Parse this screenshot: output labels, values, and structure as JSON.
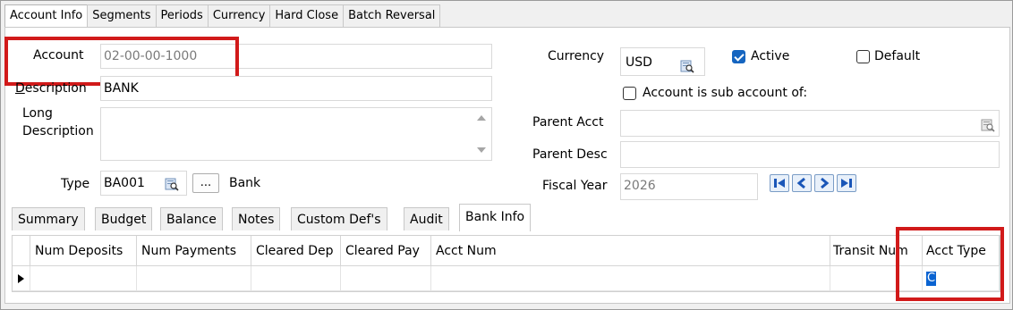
{
  "top_tabs": [
    "Account Info",
    "Segments",
    "Periods",
    "Currency",
    "Hard Close",
    "Batch Reversal"
  ],
  "form": {
    "account_label": "Account",
    "account_value": "02-00-00-1000",
    "description_label": "Description",
    "description_value": "BANK",
    "long_desc_label_1": "Long",
    "long_desc_label_2": "Description",
    "long_desc_value": "",
    "type_label": "Type",
    "type_value": "BA001",
    "type_ellipsis": "...",
    "type_name": "Bank",
    "currency_label": "Currency",
    "currency_value": "USD",
    "active_label": "Active",
    "active_checked": true,
    "default_label": "Default",
    "default_checked": false,
    "sub_account_label": "Account is sub account of:",
    "sub_account_checked": false,
    "parent_acct_label": "Parent Acct",
    "parent_acct_value": "",
    "parent_desc_label": "Parent Desc",
    "parent_desc_value": "",
    "fiscal_year_label": "Fiscal Year",
    "fiscal_year_value": "2026"
  },
  "nav_icons": [
    "first-record-icon",
    "previous-record-icon",
    "next-record-icon",
    "last-record-icon"
  ],
  "sub_tabs": [
    "Summary",
    "Budget",
    "Balance",
    "Notes",
    "Custom Def's",
    "Audit",
    "Bank Info"
  ],
  "active_sub_tab": "Bank Info",
  "grid": {
    "columns": [
      "Num Deposits",
      "Num Payments",
      "Cleared Dep",
      "Cleared Pay",
      "Acct Num",
      "Transit Num",
      "Acct Type"
    ],
    "rows": [
      {
        "num_deposits": "",
        "num_payments": "",
        "cleared_dep": "",
        "cleared_pay": "",
        "acct_num": "",
        "transit_num": "",
        "acct_type": "C"
      }
    ]
  },
  "colors": {
    "highlight_border": "#d11a1a",
    "selection": "#0a63d1",
    "checkbox_checked": "#1565c0"
  }
}
